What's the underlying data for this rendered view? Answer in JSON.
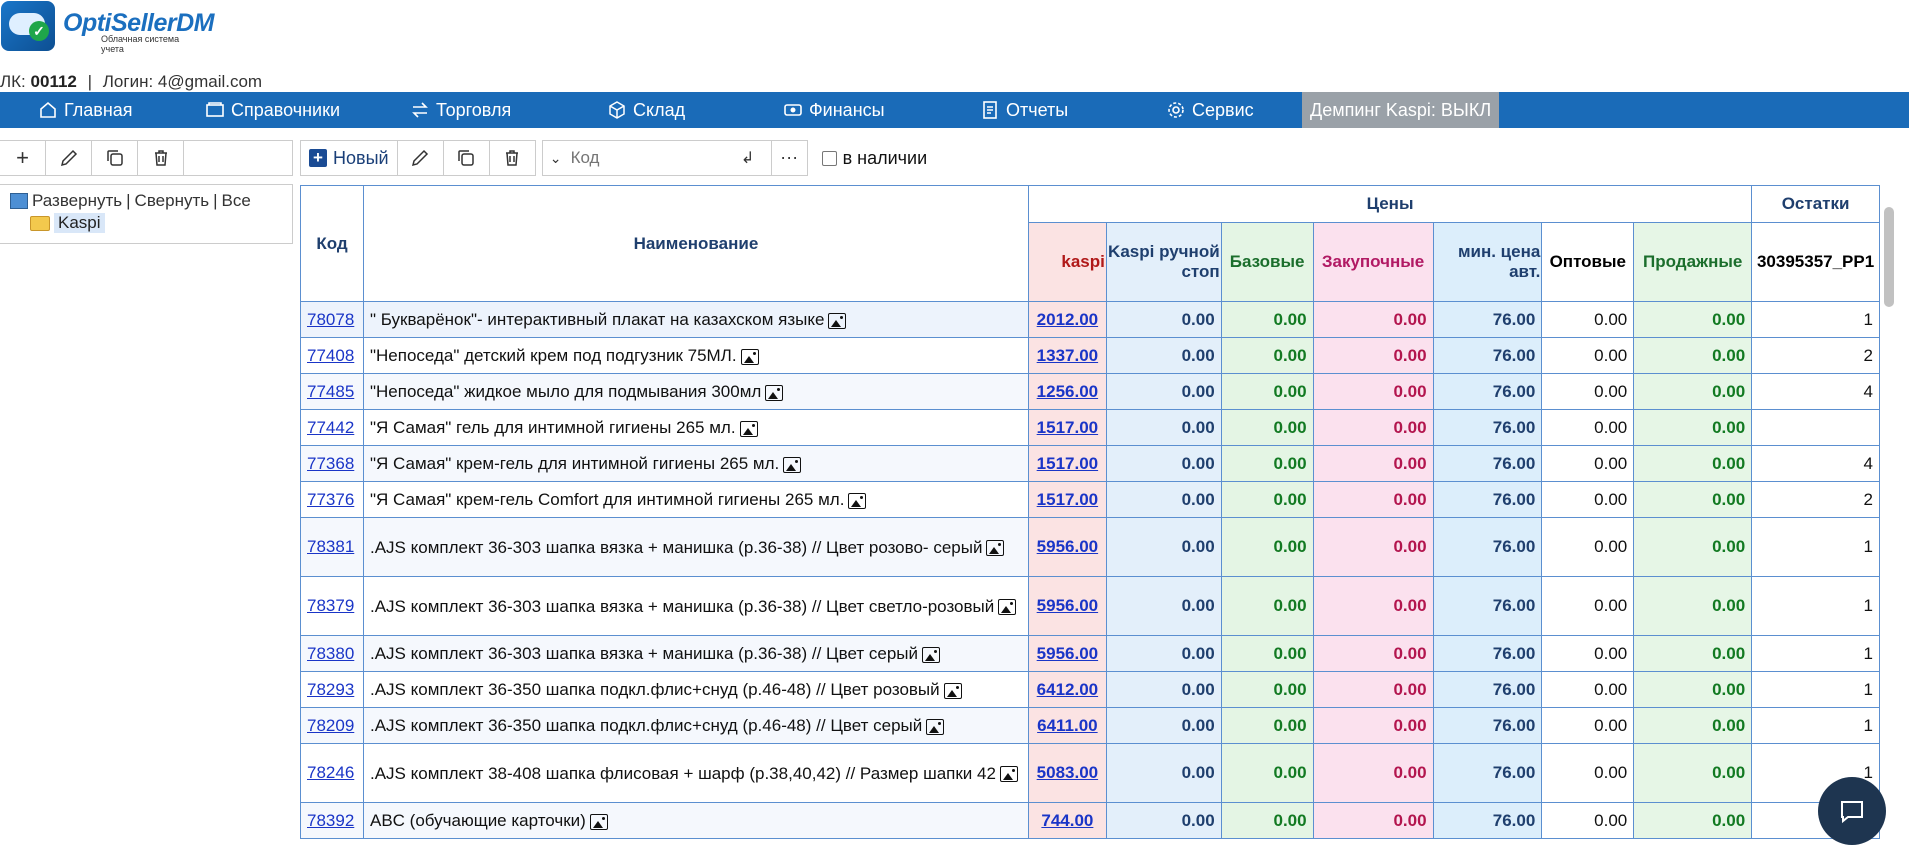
{
  "brand": {
    "title": "OptiSellerDM",
    "subtitle": "Облачная система учета"
  },
  "account": {
    "lk_label": "ЛК:",
    "lk_value": "00112",
    "separator": "|",
    "login_label": "Логин:",
    "login_value": "4@gmail.com"
  },
  "nav": {
    "items": [
      {
        "label": "Главная",
        "icon": "home-icon"
      },
      {
        "label": "Справочники",
        "icon": "folder-icon"
      },
      {
        "label": "Торговля",
        "icon": "exchange-icon"
      },
      {
        "label": "Склад",
        "icon": "box-icon"
      },
      {
        "label": "Финансы",
        "icon": "money-icon"
      },
      {
        "label": "Отчеты",
        "icon": "report-icon"
      },
      {
        "label": "Сервис",
        "icon": "gear-icon"
      }
    ],
    "dumping": "Демпинг Kaspi: ВЫКЛ"
  },
  "tree": {
    "expand": "Развернуть",
    "collapse": "Свернуть",
    "all": "Все",
    "sep": "|",
    "node": "Kaspi"
  },
  "toolbar": {
    "new_label": "Новый",
    "code_placeholder": "Код",
    "more": "···",
    "in_stock": "в наличии"
  },
  "table": {
    "headers": {
      "code": "Код",
      "name": "Наименование",
      "prices": "Цены",
      "stock": "Остатки",
      "kaspi": "kaspi",
      "manual": "Kaspi ручной стоп",
      "base": "Базовые",
      "purchase": "Закупочные",
      "min": "мин. цена авт.",
      "wholesale": "Оптовые",
      "sale": "Продажные",
      "warehouse": "30395357_PP1"
    },
    "rows": [
      {
        "code": "78078",
        "name": "\" Букварёнок\"- интерактивный плакат на казахском языке",
        "kaspi": "2012.00",
        "manual": "0.00",
        "base": "0.00",
        "purchase": "0.00",
        "min": "76.00",
        "wholesale": "0.00",
        "sale": "0.00",
        "stock": "1"
      },
      {
        "code": "77408",
        "name": "\"Непоседа\" детский крем под подгузник 75МЛ.",
        "kaspi": "1337.00",
        "manual": "0.00",
        "base": "0.00",
        "purchase": "0.00",
        "min": "76.00",
        "wholesale": "0.00",
        "sale": "0.00",
        "stock": "2"
      },
      {
        "code": "77485",
        "name": "\"Непоседа\" жидкое мыло для подмывания 300мл",
        "kaspi": "1256.00",
        "manual": "0.00",
        "base": "0.00",
        "purchase": "0.00",
        "min": "76.00",
        "wholesale": "0.00",
        "sale": "0.00",
        "stock": "4"
      },
      {
        "code": "77442",
        "name": "\"Я Самая\" гель для интимной гигиены 265 мл.",
        "kaspi": "1517.00",
        "manual": "0.00",
        "base": "0.00",
        "purchase": "0.00",
        "min": "76.00",
        "wholesale": "0.00",
        "sale": "0.00",
        "stock": ""
      },
      {
        "code": "77368",
        "name": "\"Я Самая\" крем-гель для интимной гигиены 265 мл.",
        "kaspi": "1517.00",
        "manual": "0.00",
        "base": "0.00",
        "purchase": "0.00",
        "min": "76.00",
        "wholesale": "0.00",
        "sale": "0.00",
        "stock": "4"
      },
      {
        "code": "77376",
        "name": "\"Я Самая\" крем-гель Comfort для интимной гигиены 265 мл.",
        "kaspi": "1517.00",
        "manual": "0.00",
        "base": "0.00",
        "purchase": "0.00",
        "min": "76.00",
        "wholesale": "0.00",
        "sale": "0.00",
        "stock": "2"
      },
      {
        "code": "78381",
        "name": ".AJS комплект 36-303 шапка вязка + манишка (р.36-38) // Цвет розово- серый",
        "kaspi": "5956.00",
        "manual": "0.00",
        "base": "0.00",
        "purchase": "0.00",
        "min": "76.00",
        "wholesale": "0.00",
        "sale": "0.00",
        "stock": "1"
      },
      {
        "code": "78379",
        "name": ".AJS комплект 36-303 шапка вязка + манишка (р.36-38) // Цвет светло-розовый",
        "kaspi": "5956.00",
        "manual": "0.00",
        "base": "0.00",
        "purchase": "0.00",
        "min": "76.00",
        "wholesale": "0.00",
        "sale": "0.00",
        "stock": "1"
      },
      {
        "code": "78380",
        "name": ".AJS комплект 36-303 шапка вязка + манишка (р.36-38) // Цвет серый",
        "kaspi": "5956.00",
        "manual": "0.00",
        "base": "0.00",
        "purchase": "0.00",
        "min": "76.00",
        "wholesale": "0.00",
        "sale": "0.00",
        "stock": "1"
      },
      {
        "code": "78293",
        "name": ".AJS комплект 36-350 шапка подкл.флис+снуд (р.46-48) // Цвет розовый",
        "kaspi": "6412.00",
        "manual": "0.00",
        "base": "0.00",
        "purchase": "0.00",
        "min": "76.00",
        "wholesale": "0.00",
        "sale": "0.00",
        "stock": "1"
      },
      {
        "code": "78209",
        "name": ".AJS комплект 36-350 шапка подкл.флис+снуд (р.46-48) // Цвет серый",
        "kaspi": "6411.00",
        "manual": "0.00",
        "base": "0.00",
        "purchase": "0.00",
        "min": "76.00",
        "wholesale": "0.00",
        "sale": "0.00",
        "stock": "1"
      },
      {
        "code": "78246",
        "name": ".AJS комплект 38-408 шапка флисовая + шарф (р.38,40,42) // Размер шапки 42",
        "kaspi": "5083.00",
        "manual": "0.00",
        "base": "0.00",
        "purchase": "0.00",
        "min": "76.00",
        "wholesale": "0.00",
        "sale": "0.00",
        "stock": "1"
      },
      {
        "code": "78392",
        "name": "ABC (обучающие карточки)",
        "kaspi": "744.00",
        "manual": "0.00",
        "base": "0.00",
        "purchase": "0.00",
        "min": "76.00",
        "wholesale": "0.00",
        "sale": "0.00",
        "stock": ""
      }
    ]
  },
  "colors": {
    "nav_bg": "#1a6bb8",
    "dumping_bg": "#9aa1a8",
    "link": "#1a35c7",
    "chat_bg": "#1e3550"
  }
}
